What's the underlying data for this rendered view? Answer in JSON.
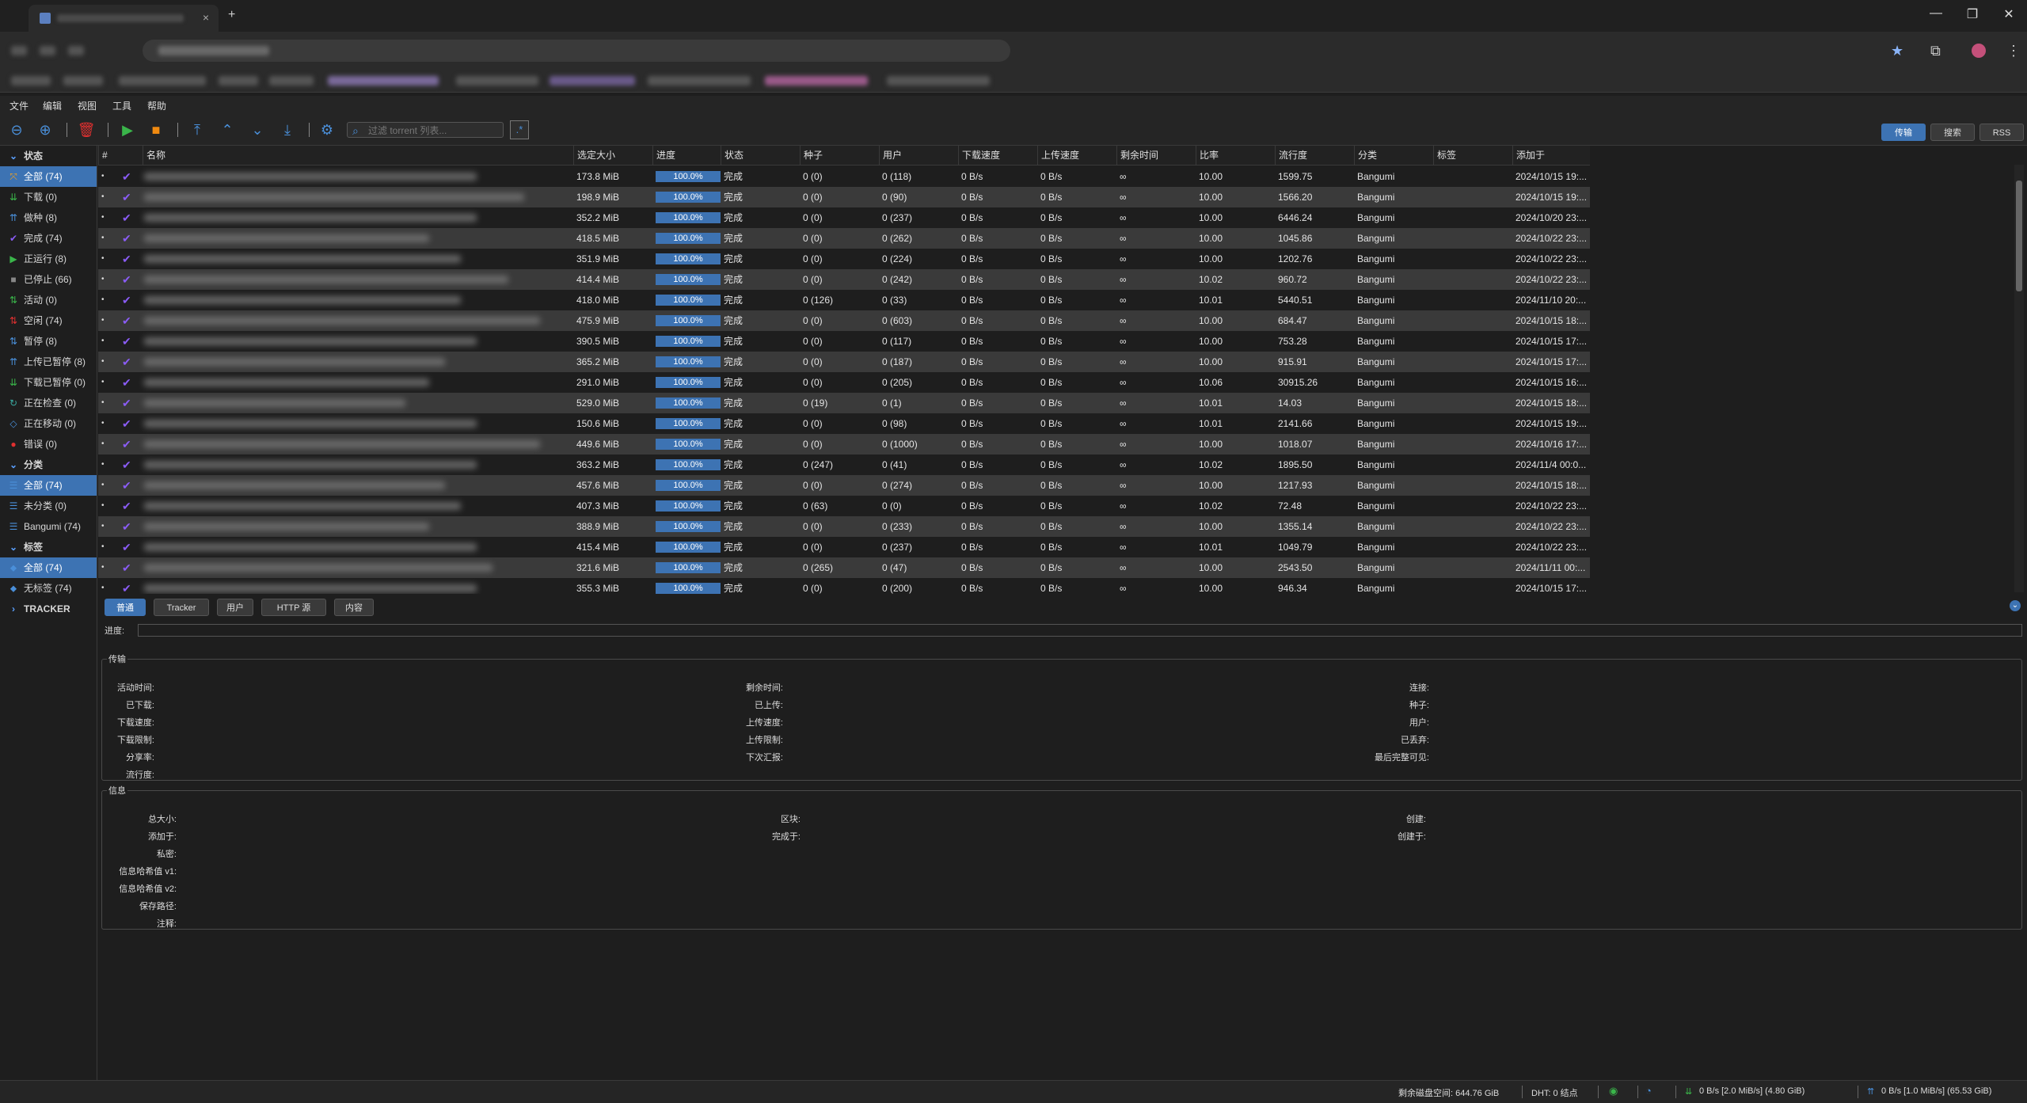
{
  "browser": {
    "close_tab_glyph": "×",
    "new_tab_glyph": "+",
    "window_buttons": [
      "—",
      "❐",
      "✕"
    ]
  },
  "menu": [
    "文件",
    "编辑",
    "视图",
    "工具",
    "帮助"
  ],
  "toolbar": {
    "filter_placeholder": "过滤 torrent 列表...",
    "regex_label": ".*",
    "right_tabs": [
      "传输",
      "搜索",
      "RSS"
    ]
  },
  "sidebar": {
    "status_header": "状态",
    "status_items": [
      {
        "label": "全部 (74)",
        "icon": "all-icon",
        "glyph": "⤧",
        "color": "#f0a020"
      },
      {
        "label": "下载 (0)",
        "icon": "download-icon",
        "glyph": "⇊",
        "color": "#3ab54a"
      },
      {
        "label": "做种 (8)",
        "icon": "seeding-icon",
        "glyph": "⇈",
        "color": "#4a8fd9"
      },
      {
        "label": "完成 (74)",
        "icon": "completed-icon",
        "glyph": "✔",
        "color": "#8a5cf5"
      },
      {
        "label": "正运行 (8)",
        "icon": "running-icon",
        "glyph": "▶",
        "color": "#3ab54a"
      },
      {
        "label": "已停止 (66)",
        "icon": "stopped-icon",
        "glyph": "■",
        "color": "#888888"
      },
      {
        "label": "活动 (0)",
        "icon": "active-icon",
        "glyph": "⇅",
        "color": "#3ab54a"
      },
      {
        "label": "空闲 (74)",
        "icon": "inactive-icon",
        "glyph": "⇅",
        "color": "#e03030"
      },
      {
        "label": "暂停 (8)",
        "icon": "stalled-icon",
        "glyph": "⇅",
        "color": "#4a8fd9"
      },
      {
        "label": "上传已暂停 (8)",
        "icon": "stalled-upload-icon",
        "glyph": "⇈",
        "color": "#4a8fd9"
      },
      {
        "label": "下载已暂停 (0)",
        "icon": "stalled-download-icon",
        "glyph": "⇊",
        "color": "#3ab54a"
      },
      {
        "label": "正在检查 (0)",
        "icon": "checking-icon",
        "glyph": "↻",
        "color": "#3aa9a0"
      },
      {
        "label": "正在移动 (0)",
        "icon": "moving-icon",
        "glyph": "◇",
        "color": "#4a8fd9"
      },
      {
        "label": "错误 (0)",
        "icon": "error-icon",
        "glyph": "●",
        "color": "#e03030"
      }
    ],
    "category_header": "分类",
    "category_items": [
      {
        "label": "全部 (74)",
        "icon": "list-icon",
        "glyph": "☰",
        "color": "#4a8fd9"
      },
      {
        "label": "未分类 (0)",
        "icon": "list-icon",
        "glyph": "☰",
        "color": "#4a8fd9"
      },
      {
        "label": "Bangumi (74)",
        "icon": "list-icon",
        "glyph": "☰",
        "color": "#4a8fd9"
      }
    ],
    "tag_header": "标签",
    "tag_items": [
      {
        "label": "全部 (74)",
        "icon": "tag-icon",
        "glyph": "⬥",
        "color": "#4a8fd9"
      },
      {
        "label": "无标签 (74)",
        "icon": "tag-icon",
        "glyph": "⬥",
        "color": "#4a8fd9"
      }
    ],
    "tracker_header": "TRACKER"
  },
  "table": {
    "headers": [
      "#",
      "名称",
      "选定大小",
      "进度",
      "状态",
      "种子",
      "用户",
      "下载速度",
      "上传速度",
      "剩余时间",
      "比率",
      "流行度",
      "分类",
      "标签",
      "添加于"
    ],
    "rows": [
      {
        "size": "173.8 MiB",
        "progress": "100.0%",
        "status": "完成",
        "seeds": "0 (0)",
        "peers": "0 (118)",
        "dl": "0 B/s",
        "ul": "0 B/s",
        "eta": "∞",
        "ratio": "10.00",
        "popularity": "1599.75",
        "category": "Bangumi",
        "tags": "",
        "added": "2024/10/15 19:..."
      },
      {
        "size": "198.9 MiB",
        "progress": "100.0%",
        "status": "完成",
        "seeds": "0 (0)",
        "peers": "0 (90)",
        "dl": "0 B/s",
        "ul": "0 B/s",
        "eta": "∞",
        "ratio": "10.00",
        "popularity": "1566.20",
        "category": "Bangumi",
        "tags": "",
        "added": "2024/10/15 19:..."
      },
      {
        "size": "352.2 MiB",
        "progress": "100.0%",
        "status": "完成",
        "seeds": "0 (0)",
        "peers": "0 (237)",
        "dl": "0 B/s",
        "ul": "0 B/s",
        "eta": "∞",
        "ratio": "10.00",
        "popularity": "6446.24",
        "category": "Bangumi",
        "tags": "",
        "added": "2024/10/20 23:..."
      },
      {
        "size": "418.5 MiB",
        "progress": "100.0%",
        "status": "完成",
        "seeds": "0 (0)",
        "peers": "0 (262)",
        "dl": "0 B/s",
        "ul": "0 B/s",
        "eta": "∞",
        "ratio": "10.00",
        "popularity": "1045.86",
        "category": "Bangumi",
        "tags": "",
        "added": "2024/10/22 23:..."
      },
      {
        "size": "351.9 MiB",
        "progress": "100.0%",
        "status": "完成",
        "seeds": "0 (0)",
        "peers": "0 (224)",
        "dl": "0 B/s",
        "ul": "0 B/s",
        "eta": "∞",
        "ratio": "10.00",
        "popularity": "1202.76",
        "category": "Bangumi",
        "tags": "",
        "added": "2024/10/22 23:..."
      },
      {
        "size": "414.4 MiB",
        "progress": "100.0%",
        "status": "完成",
        "seeds": "0 (0)",
        "peers": "0 (242)",
        "dl": "0 B/s",
        "ul": "0 B/s",
        "eta": "∞",
        "ratio": "10.02",
        "popularity": "960.72",
        "category": "Bangumi",
        "tags": "",
        "added": "2024/10/22 23:..."
      },
      {
        "size": "418.0 MiB",
        "progress": "100.0%",
        "status": "完成",
        "seeds": "0 (126)",
        "peers": "0 (33)",
        "dl": "0 B/s",
        "ul": "0 B/s",
        "eta": "∞",
        "ratio": "10.01",
        "popularity": "5440.51",
        "category": "Bangumi",
        "tags": "",
        "added": "2024/11/10 20:..."
      },
      {
        "size": "475.9 MiB",
        "progress": "100.0%",
        "status": "完成",
        "seeds": "0 (0)",
        "peers": "0 (603)",
        "dl": "0 B/s",
        "ul": "0 B/s",
        "eta": "∞",
        "ratio": "10.00",
        "popularity": "684.47",
        "category": "Bangumi",
        "tags": "",
        "added": "2024/10/15 18:..."
      },
      {
        "size": "390.5 MiB",
        "progress": "100.0%",
        "status": "完成",
        "seeds": "0 (0)",
        "peers": "0 (117)",
        "dl": "0 B/s",
        "ul": "0 B/s",
        "eta": "∞",
        "ratio": "10.00",
        "popularity": "753.28",
        "category": "Bangumi",
        "tags": "",
        "added": "2024/10/15 17:..."
      },
      {
        "size": "365.2 MiB",
        "progress": "100.0%",
        "status": "完成",
        "seeds": "0 (0)",
        "peers": "0 (187)",
        "dl": "0 B/s",
        "ul": "0 B/s",
        "eta": "∞",
        "ratio": "10.00",
        "popularity": "915.91",
        "category": "Bangumi",
        "tags": "",
        "added": "2024/10/15 17:..."
      },
      {
        "size": "291.0 MiB",
        "progress": "100.0%",
        "status": "完成",
        "seeds": "0 (0)",
        "peers": "0 (205)",
        "dl": "0 B/s",
        "ul": "0 B/s",
        "eta": "∞",
        "ratio": "10.06",
        "popularity": "30915.26",
        "category": "Bangumi",
        "tags": "",
        "added": "2024/10/15 16:..."
      },
      {
        "size": "529.0 MiB",
        "progress": "100.0%",
        "status": "完成",
        "seeds": "0 (19)",
        "peers": "0 (1)",
        "dl": "0 B/s",
        "ul": "0 B/s",
        "eta": "∞",
        "ratio": "10.01",
        "popularity": "14.03",
        "category": "Bangumi",
        "tags": "",
        "added": "2024/10/15 18:..."
      },
      {
        "size": "150.6 MiB",
        "progress": "100.0%",
        "status": "完成",
        "seeds": "0 (0)",
        "peers": "0 (98)",
        "dl": "0 B/s",
        "ul": "0 B/s",
        "eta": "∞",
        "ratio": "10.01",
        "popularity": "2141.66",
        "category": "Bangumi",
        "tags": "",
        "added": "2024/10/15 19:..."
      },
      {
        "size": "449.6 MiB",
        "progress": "100.0%",
        "status": "完成",
        "seeds": "0 (0)",
        "peers": "0 (1000)",
        "dl": "0 B/s",
        "ul": "0 B/s",
        "eta": "∞",
        "ratio": "10.00",
        "popularity": "1018.07",
        "category": "Bangumi",
        "tags": "",
        "added": "2024/10/16 17:..."
      },
      {
        "size": "363.2 MiB",
        "progress": "100.0%",
        "status": "完成",
        "seeds": "0 (247)",
        "peers": "0 (41)",
        "dl": "0 B/s",
        "ul": "0 B/s",
        "eta": "∞",
        "ratio": "10.02",
        "popularity": "1895.50",
        "category": "Bangumi",
        "tags": "",
        "added": "2024/11/4 00:0..."
      },
      {
        "size": "457.6 MiB",
        "progress": "100.0%",
        "status": "完成",
        "seeds": "0 (0)",
        "peers": "0 (274)",
        "dl": "0 B/s",
        "ul": "0 B/s",
        "eta": "∞",
        "ratio": "10.00",
        "popularity": "1217.93",
        "category": "Bangumi",
        "tags": "",
        "added": "2024/10/15 18:..."
      },
      {
        "size": "407.3 MiB",
        "progress": "100.0%",
        "status": "完成",
        "seeds": "0 (63)",
        "peers": "0 (0)",
        "dl": "0 B/s",
        "ul": "0 B/s",
        "eta": "∞",
        "ratio": "10.02",
        "popularity": "72.48",
        "category": "Bangumi",
        "tags": "",
        "added": "2024/10/22 23:..."
      },
      {
        "size": "388.9 MiB",
        "progress": "100.0%",
        "status": "完成",
        "seeds": "0 (0)",
        "peers": "0 (233)",
        "dl": "0 B/s",
        "ul": "0 B/s",
        "eta": "∞",
        "ratio": "10.00",
        "popularity": "1355.14",
        "category": "Bangumi",
        "tags": "",
        "added": "2024/10/22 23:..."
      },
      {
        "size": "415.4 MiB",
        "progress": "100.0%",
        "status": "完成",
        "seeds": "0 (0)",
        "peers": "0 (237)",
        "dl": "0 B/s",
        "ul": "0 B/s",
        "eta": "∞",
        "ratio": "10.01",
        "popularity": "1049.79",
        "category": "Bangumi",
        "tags": "",
        "added": "2024/10/22 23:..."
      },
      {
        "size": "321.6 MiB",
        "progress": "100.0%",
        "status": "完成",
        "seeds": "0 (265)",
        "peers": "0 (47)",
        "dl": "0 B/s",
        "ul": "0 B/s",
        "eta": "∞",
        "ratio": "10.00",
        "popularity": "2543.50",
        "category": "Bangumi",
        "tags": "",
        "added": "2024/11/11 00:..."
      },
      {
        "size": "355.3 MiB",
        "progress": "100.0%",
        "status": "完成",
        "seeds": "0 (0)",
        "peers": "0 (200)",
        "dl": "0 B/s",
        "ul": "0 B/s",
        "eta": "∞",
        "ratio": "10.00",
        "popularity": "946.34",
        "category": "Bangumi",
        "tags": "",
        "added": "2024/10/15 17:..."
      }
    ]
  },
  "properties": {
    "tabs": [
      "普通",
      "Tracker",
      "用户",
      "HTTP 源",
      "内容"
    ],
    "progress_label": "进度:",
    "transfer_title": "传输",
    "transfer_col1": [
      "活动时间:",
      "已下载:",
      "下载速度:",
      "下载限制:",
      "分享率:",
      "流行度:"
    ],
    "transfer_col2": [
      "剩余时间:",
      "已上传:",
      "上传速度:",
      "上传限制:",
      "下次汇报:"
    ],
    "transfer_col3": [
      "连接:",
      "种子:",
      "用户:",
      "已丢弃:",
      "最后完整可见:"
    ],
    "info_title": "信息",
    "info_col1": [
      "总大小:",
      "添加于:",
      "私密:",
      "信息哈希值 v1:",
      "信息哈希值 v2:",
      "保存路径:",
      "注释:"
    ],
    "info_col2": [
      "区块:",
      "完成于:"
    ],
    "info_col3": [
      "创建:",
      "创建于:"
    ]
  },
  "statusbar": {
    "free_space": "剩余磁盘空间: 644.76 GiB",
    "dht": "DHT: 0 结点",
    "download": "0 B/s [2.0 MiB/s] (4.80 GiB)",
    "upload": "0 B/s [1.0 MiB/s] (65.53 GiB)"
  }
}
